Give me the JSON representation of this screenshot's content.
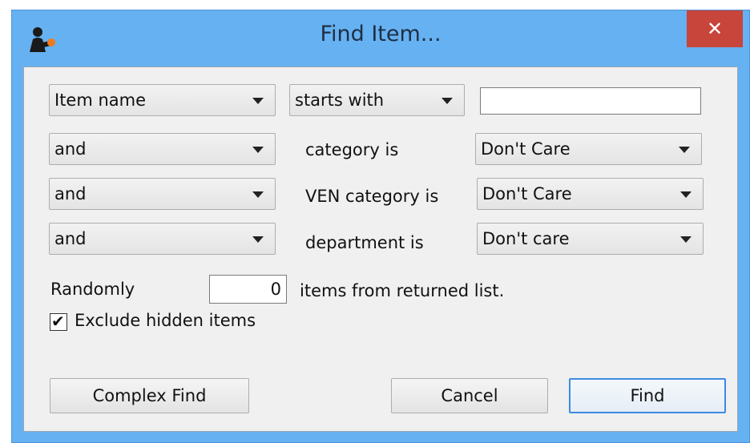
{
  "window": {
    "title": "Find Item...",
    "close_glyph": "✕"
  },
  "row1": {
    "field": "Item name",
    "operator": "starts with",
    "value": ""
  },
  "row2": {
    "conjunction": "and",
    "label": "category is",
    "value": "Don't Care"
  },
  "row3": {
    "conjunction": "and",
    "label": "VEN category is",
    "value": "Don't Care"
  },
  "row4": {
    "conjunction": "and",
    "label": "department is",
    "value": "Don't care"
  },
  "random": {
    "label": "Randomly",
    "count": "0",
    "suffix": "items from returned list."
  },
  "exclude_hidden": {
    "label": "Exclude hidden items",
    "checked": true,
    "check_glyph": "✔"
  },
  "buttons": {
    "complex_find": "Complex Find",
    "cancel": "Cancel",
    "find": "Find"
  },
  "colors": {
    "titlebar": "#66b1f2",
    "close": "#c7453b",
    "client": "#f0f0f0",
    "default_button_border": "#3c8be0"
  }
}
